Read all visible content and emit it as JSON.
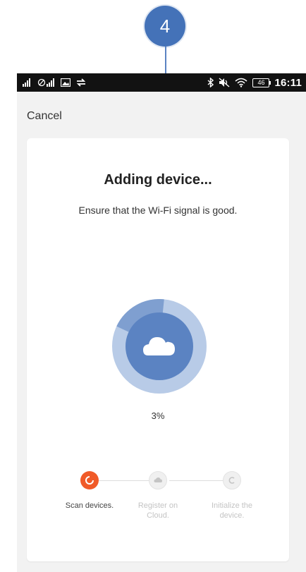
{
  "annotation": {
    "step_number": "4"
  },
  "status_bar": {
    "battery": "46",
    "time": "16:11",
    "left_icons": [
      "signal-icon",
      "no-signal-icon",
      "image-icon",
      "sync-icon"
    ],
    "right_icons": [
      "bluetooth-icon",
      "mute-icon",
      "wifi-icon",
      "battery-icon"
    ]
  },
  "header": {
    "cancel_label": "Cancel"
  },
  "main": {
    "title": "Adding device...",
    "subtitle": "Ensure that the Wi-Fi signal is good.",
    "progress_fraction": 0.03,
    "progress_label": "3%"
  },
  "steps": [
    {
      "label": "Scan devices.",
      "state": "active",
      "icon": "scan-icon"
    },
    {
      "label": "Register on Cloud.",
      "state": "inactive",
      "icon": "cloud-icon"
    },
    {
      "label": "Initialize the device.",
      "state": "inactive",
      "icon": "init-icon"
    }
  ],
  "colors": {
    "accent_blue": "#4472b8",
    "progress_outer": "#b8cbe7",
    "progress_arc": "#7f9fd0",
    "progress_inner": "#5b83c2",
    "active_step": "#f05a28",
    "inactive_step": "#cccccc"
  }
}
